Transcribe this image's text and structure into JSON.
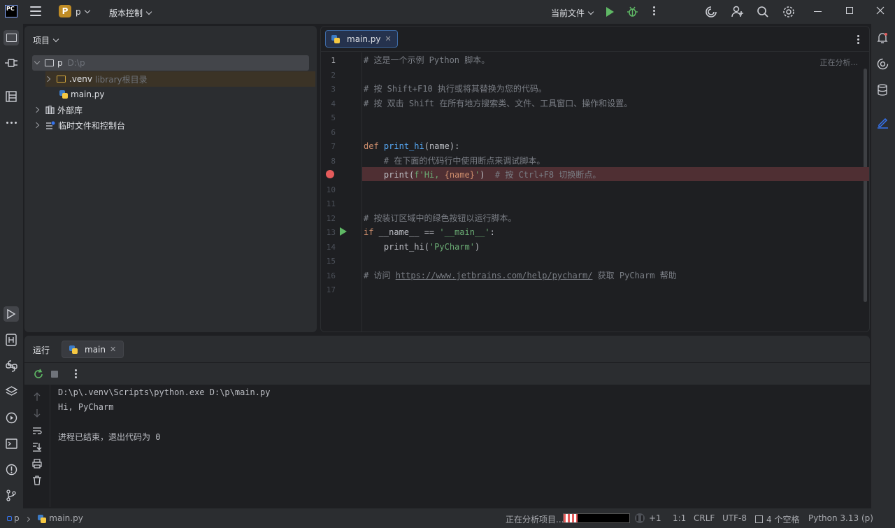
{
  "titlebar": {
    "logo_text": "PC",
    "project_badge": "P",
    "project_name": "p",
    "vcs_label": "版本控制",
    "run_config": "当前文件"
  },
  "project_panel": {
    "title": "项目",
    "tree": [
      {
        "label": "p",
        "hint": "D:\\p",
        "expanded": true,
        "selected": true
      },
      {
        "label": ".venv",
        "hint": "library根目录",
        "expanded": false
      },
      {
        "label": "main.py",
        "hint": ""
      },
      {
        "label": "外部库",
        "hint": "",
        "expanded": false
      },
      {
        "label": "临时文件和控制台",
        "hint": "",
        "expanded": false
      }
    ]
  },
  "editor": {
    "tab_label": "main.py",
    "status_hint": "正在分析...",
    "line_numbers": [
      "1",
      "2",
      "3",
      "4",
      "5",
      "6",
      "7",
      "8",
      "9",
      "10",
      "11",
      "12",
      "13",
      "14",
      "15",
      "16",
      "17"
    ],
    "lines": {
      "l1": "# 这是一个示例 Python 脚本。",
      "l3": "# 按 Shift+F10 执行或将其替换为您的代码。",
      "l4": "# 按 双击 Shift 在所有地方搜索类、文件、工具窗口、操作和设置。",
      "l7_kw": "def",
      "l7_fn": "print_hi",
      "l7_rest": "(name):",
      "l8": "    # 在下面的代码行中使用断点来调试脚本。",
      "l9_a": "    print(",
      "l9_str1": "f'Hi, ",
      "l9_b": "{name}",
      "l9_str2": "'",
      "l9_c": ")  ",
      "l9_cmt": "# 按 Ctrl+F8 切换断点。",
      "l12": "# 按装订区域中的绿色按钮以运行脚本。",
      "l13_kw": "if",
      "l13_a": " __name__ == ",
      "l13_str": "'__main__'",
      "l13_b": ":",
      "l14_a": "    print_hi(",
      "l14_str": "'PyCharm'",
      "l14_b": ")",
      "l16_a": "# 访问 ",
      "l16_link": "https://www.jetbrains.com/help/pycharm/",
      "l16_b": " 获取 PyCharm 帮助"
    }
  },
  "run_panel": {
    "title": "运行",
    "tab_label": "main",
    "output": [
      "D:\\p\\.venv\\Scripts\\python.exe D:\\p\\main.py",
      "Hi, PyCharm",
      "",
      "进程已结束，退出代码为 0"
    ]
  },
  "statusbar": {
    "breadcrumb_project": "p",
    "breadcrumb_file": "main.py",
    "analyzing": "正在分析项目...",
    "plus": "+1",
    "position": "1:1",
    "line_sep": "CRLF",
    "encoding": "UTF-8",
    "indent": "4 个空格",
    "interpreter": "Python 3.13 (p)"
  },
  "colors": {
    "accent": "#3574f0",
    "run_green": "#5fb865",
    "breakpoint_red": "#e55b5b",
    "badge_orange": "#c08c25"
  }
}
